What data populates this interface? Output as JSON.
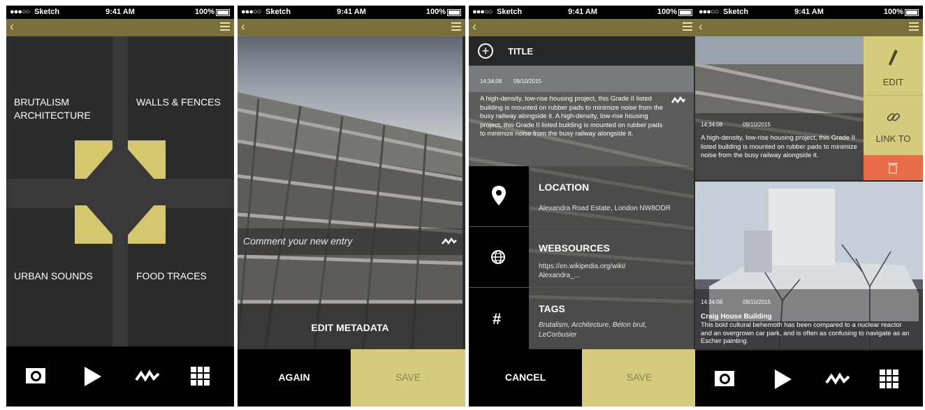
{
  "status": {
    "carrier": "Sketch",
    "time": "9:41 AM",
    "battery": "100%"
  },
  "screen1": {
    "categories": [
      "BRUTALISM ARCHITECTURE",
      "WALLS & FENCES",
      "URBAN SOUNDS",
      "FOOD TRACES"
    ],
    "accent": "#d4c76e"
  },
  "screen2": {
    "comment_placeholder": "Comment your new entry",
    "edit_metadata": "EDIT METADATA",
    "again": "AGAIN",
    "save": "SAVE"
  },
  "screen3": {
    "title": "TITLE",
    "time": "14:34:08",
    "date": "09/10/2015",
    "description": "A high-density, low-rise housing project, this Grade II listed building is mounted on rubber pads to minimize noise from the busy railway alongside it. A high-density, low-rise housing project, this Grade II listed building is mounted on rubber pads to minimize noise from the busy railway alongside it.",
    "location_label": "LOCATION",
    "location_value": "Alexandra Road Estate, London NW8ODR",
    "websources_label": "WEBSOURCES",
    "websources_value": "https://en.wikipedia.org/wiki/ Alexandra_...",
    "tags_label": "TAGS",
    "tags_value": "Brutalism, Architecture, Béton brut, LeCorbusier",
    "cancel": "CANCEL",
    "save": "SAVE"
  },
  "screen4": {
    "edit": "EDIT",
    "link_to": "LINK TO",
    "entry1": {
      "time": "14:34:08",
      "date": "09/10/2015",
      "text": "A high-density, low-rise housing project, this Grade II listed building is mounted on rubber pads to minimize noise from the busy railway alongside it."
    },
    "entry2": {
      "time": "14:34:08",
      "date": "09/10/2015",
      "title": "Craig House Building",
      "text": "This bold cultural behemoth has been compared to a nuclear reactor and an overgrown car park, and is often as confusing to navigate as an Escher painting."
    }
  }
}
